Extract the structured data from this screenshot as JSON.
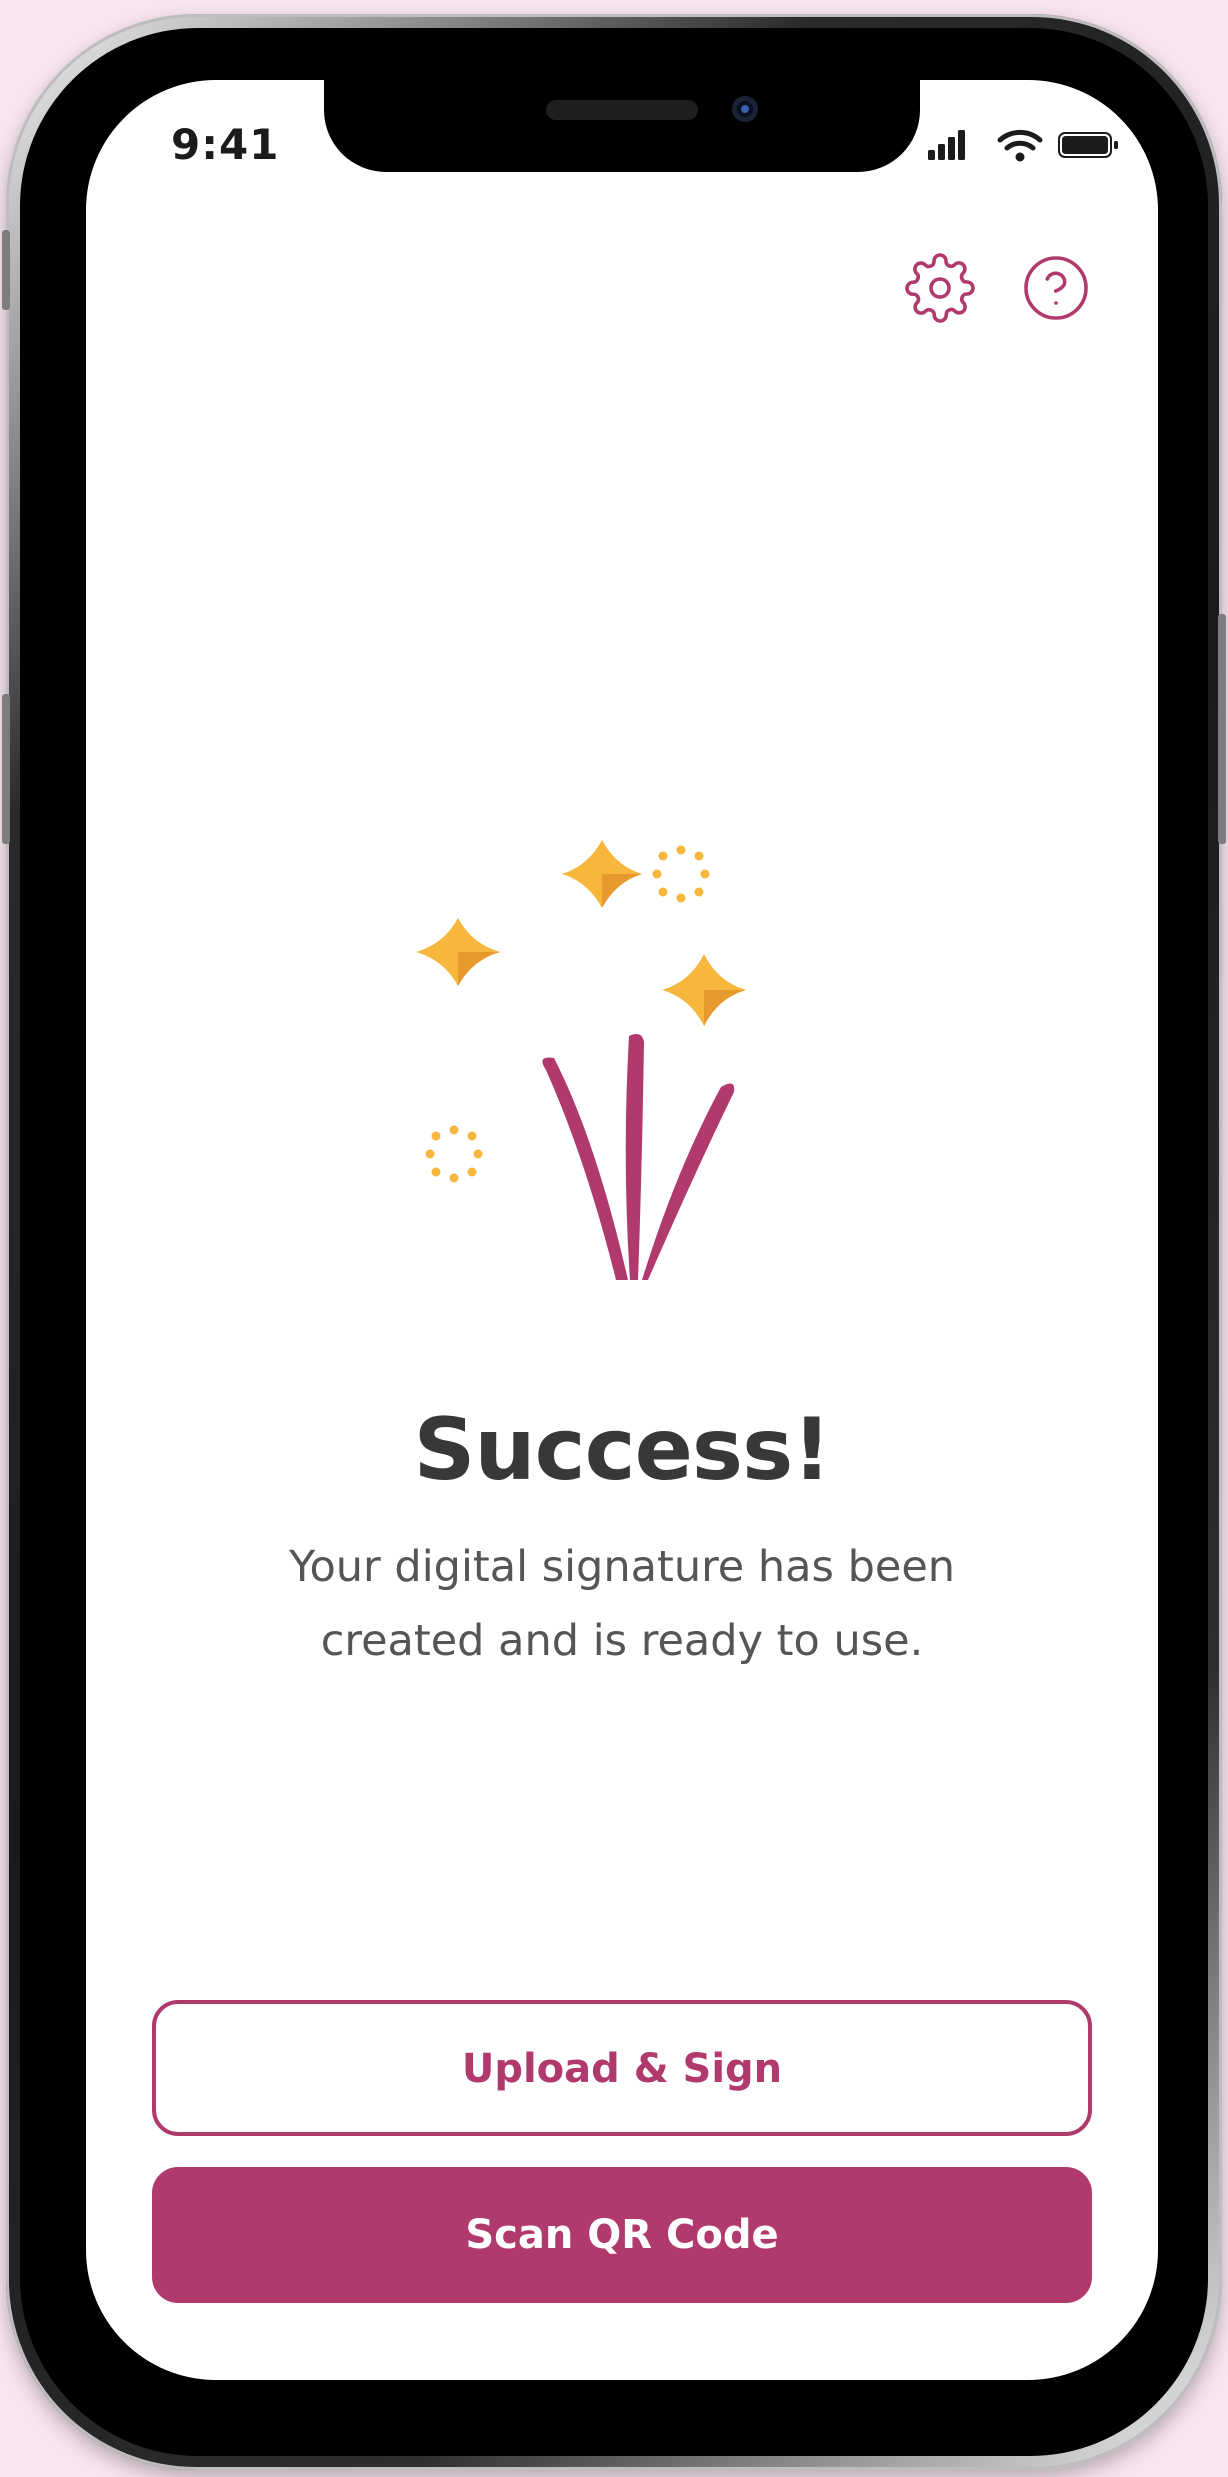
{
  "status_bar": {
    "time": "9:41"
  },
  "header": {
    "settings_icon": "gear-icon",
    "help_icon": "help-circle-icon"
  },
  "illustration": {
    "icon": "fireworks-icon"
  },
  "main": {
    "title": "Success!",
    "subtitle_line1": "Your digital signature has been",
    "subtitle_line2": "created and is ready to use."
  },
  "actions": {
    "upload_sign_label": "Upload & Sign",
    "scan_qr_label": "Scan QR Code"
  },
  "colors": {
    "accent": "#b03a6e",
    "star": "#f6b73c",
    "star_shadow": "#e69a2e",
    "background": "#f7e4ee"
  }
}
